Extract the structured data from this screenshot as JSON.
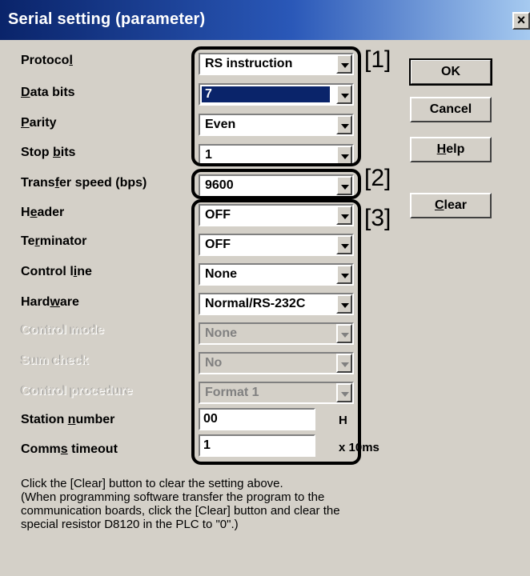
{
  "window": {
    "title": "Serial setting (parameter)",
    "close_label": "×"
  },
  "labels": {
    "protocol": [
      "Protoco",
      "l",
      ""
    ],
    "data_bits": [
      "",
      "D",
      "ata bits"
    ],
    "parity": [
      "",
      "P",
      "arity"
    ],
    "stop_bits": [
      "Stop ",
      "b",
      "its"
    ],
    "transfer_speed": [
      "Trans",
      "f",
      "er speed (bps)"
    ],
    "header": [
      "H",
      "e",
      "ader"
    ],
    "terminator": [
      "Te",
      "r",
      "minator"
    ],
    "control_line": [
      "Control l",
      "i",
      "ne"
    ],
    "hardware": [
      "Hard",
      "w",
      "are"
    ],
    "control_mode": "Control mode",
    "sum_check": "Sum check",
    "control_procedure": "Control procedure",
    "station_number": [
      "Station ",
      "n",
      "umber"
    ],
    "comms_timeout": [
      "Comm",
      "s",
      " timeout"
    ]
  },
  "values": {
    "protocol": "RS instruction",
    "data_bits": "7",
    "parity": "Even",
    "stop_bits": "1",
    "transfer_speed": "9600",
    "header": "OFF",
    "terminator": "OFF",
    "control_line": "None",
    "hardware": "Normal/RS-232C",
    "control_mode": "None",
    "sum_check": "No",
    "control_procedure": "Format 1",
    "station_number": "00",
    "comms_timeout": "1"
  },
  "units": {
    "station_number": "H",
    "comms_timeout": "x 10ms"
  },
  "buttons": {
    "ok": "OK",
    "cancel": "Cancel",
    "help": [
      "",
      "H",
      "elp"
    ],
    "clear": [
      "",
      "C",
      "lear"
    ]
  },
  "markers": {
    "m1": "[1]",
    "m2": "[2]",
    "m3": "[3]"
  },
  "note": "Click the [Clear] button to clear the setting above.\n(When programming software transfer the program to the\ncommunication boards, click the [Clear] button and clear the\nspecial resistor D8120 in the PLC to \"0\".)"
}
